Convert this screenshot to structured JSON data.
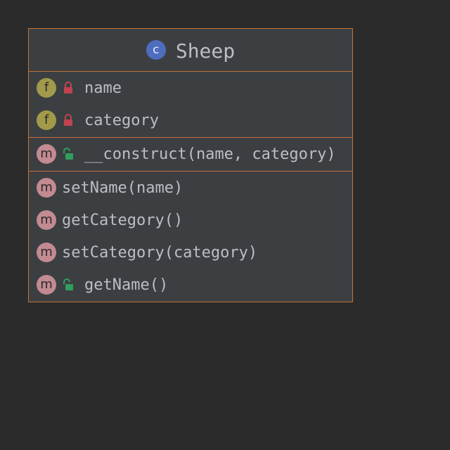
{
  "class": {
    "name": "Sheep",
    "badge": "c",
    "fields": [
      {
        "badge": "f",
        "visibility": "private",
        "label": "name"
      },
      {
        "badge": "f",
        "visibility": "private",
        "label": "category"
      }
    ],
    "constructors": [
      {
        "badge": "m",
        "visibility": "public",
        "label": "__construct(name, category)"
      }
    ],
    "methods": [
      {
        "badge": "m",
        "visibility": "",
        "label": "setName(name)"
      },
      {
        "badge": "m",
        "visibility": "",
        "label": "getCategory()"
      },
      {
        "badge": "m",
        "visibility": "",
        "label": "setCategory(category)"
      },
      {
        "badge": "m",
        "visibility": "public",
        "label": "getName()"
      }
    ]
  },
  "colors": {
    "background": "#2b2b2b",
    "box": "#3c3f41",
    "border": "#c0733a",
    "text": "#bbbec4",
    "class_badge": "#4f6dbf",
    "field_badge": "#a19a4a",
    "method_badge": "#c28a91",
    "private_lock": "#c0434f",
    "public_lock": "#2f9e5e"
  },
  "icons": {
    "private": "lock-closed-icon",
    "public": "lock-open-icon"
  }
}
